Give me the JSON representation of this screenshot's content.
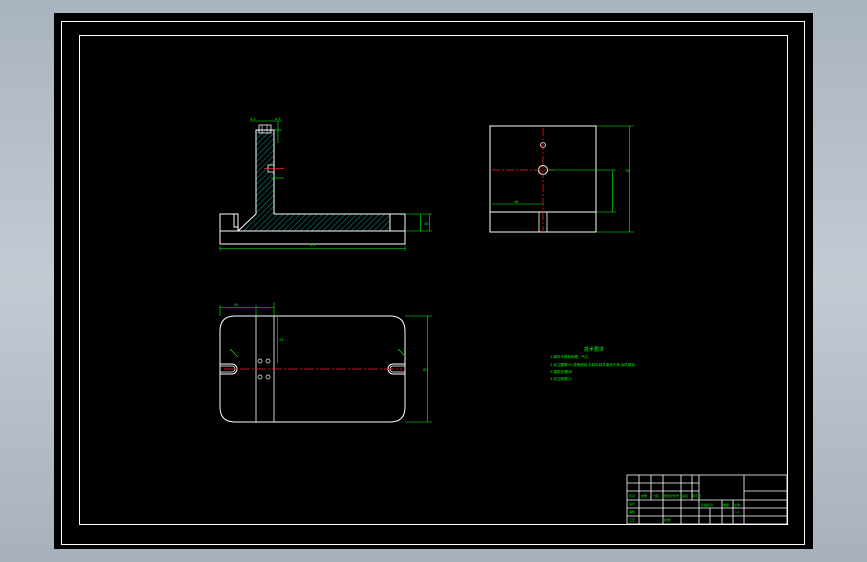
{
  "colors": {
    "background": "#000000",
    "outline": "#ffffff",
    "dimension": "#00ff00",
    "centerline": "#ff2020",
    "hatch": "#00bfbf",
    "note_text": "#00ff00",
    "title_block_text": "#00ff00"
  },
  "drawing": {
    "views": [
      "front-section-view",
      "side-view",
      "top-view"
    ],
    "dimensions": {
      "front_top_left": "4.5",
      "front_top_right": "4.5",
      "front_overall_width": "2.4",
      "front_right_height": "38",
      "side_height": "78",
      "side_offset": "48",
      "top_width_a": "45",
      "top_height_b": "24",
      "top_overall_height": "80"
    },
    "notes": {
      "heading": "技术要求",
      "lines": [
        "1.铸件不得有砂眼、气孔",
        "2.未注圆角R3,锐角倒钝,去除毛刺并清洗干净,涂防锈油",
        "3.调质处理HB",
        "4.未注倒角C1"
      ]
    },
    "title_block": {
      "row_labels": [
        "标记",
        "处数",
        "分区",
        "更改文件号",
        "签名",
        "年月日"
      ],
      "labels": [
        "设计",
        "审核",
        "工艺",
        "批准"
      ],
      "fields": [
        "阶段标记",
        "重量",
        "比例"
      ],
      "scale": "1:1"
    }
  }
}
